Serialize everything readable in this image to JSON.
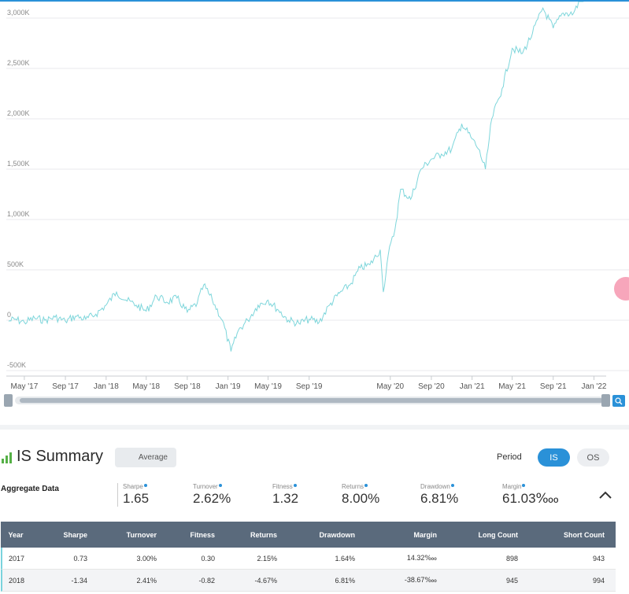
{
  "chart_data": {
    "type": "line",
    "series": [
      {
        "color": "#7ed6db",
        "points": [
          [
            "2017-03-15",
            -10000
          ],
          [
            "2017-04-01",
            10000
          ],
          [
            "2017-05-01",
            -20000
          ],
          [
            "2017-06-01",
            20000
          ],
          [
            "2017-07-01",
            0
          ],
          [
            "2017-08-01",
            30000
          ],
          [
            "2017-09-01",
            -10000
          ],
          [
            "2017-10-01",
            40000
          ],
          [
            "2017-11-01",
            10000
          ],
          [
            "2017-12-01",
            60000
          ],
          [
            "2018-01-01",
            150000
          ],
          [
            "2018-02-01",
            280000
          ],
          [
            "2018-03-01",
            200000
          ],
          [
            "2018-04-01",
            150000
          ],
          [
            "2018-05-01",
            90000
          ],
          [
            "2018-06-01",
            240000
          ],
          [
            "2018-07-01",
            180000
          ],
          [
            "2018-08-01",
            220000
          ],
          [
            "2018-09-01",
            80000
          ],
          [
            "2018-10-01",
            170000
          ],
          [
            "2018-10-20",
            350000
          ],
          [
            "2018-11-15",
            200000
          ],
          [
            "2018-12-15",
            0
          ],
          [
            "2019-01-10",
            -310000
          ],
          [
            "2019-02-01",
            -100000
          ],
          [
            "2019-03-01",
            0
          ],
          [
            "2019-04-01",
            150000
          ],
          [
            "2019-05-01",
            200000
          ],
          [
            "2019-06-01",
            100000
          ],
          [
            "2019-07-01",
            0
          ],
          [
            "2019-08-01",
            -30000
          ],
          [
            "2019-09-01",
            10000
          ],
          [
            "2019-10-01",
            -20000
          ],
          [
            "2019-11-01",
            150000
          ],
          [
            "2019-12-01",
            270000
          ],
          [
            "2020-01-01",
            350000
          ],
          [
            "2020-02-01",
            520000
          ],
          [
            "2020-03-01",
            550000
          ],
          [
            "2020-04-01",
            700000
          ],
          [
            "2020-04-10",
            280000
          ],
          [
            "2020-04-25",
            650000
          ],
          [
            "2020-05-15",
            900000
          ],
          [
            "2020-06-01",
            1300000
          ],
          [
            "2020-07-01",
            1200000
          ],
          [
            "2020-08-01",
            1500000
          ],
          [
            "2020-09-01",
            1600000
          ],
          [
            "2020-10-01",
            1650000
          ],
          [
            "2020-11-01",
            1700000
          ],
          [
            "2020-12-01",
            1950000
          ],
          [
            "2021-01-01",
            1800000
          ],
          [
            "2021-01-20",
            1700000
          ],
          [
            "2021-02-10",
            1500000
          ],
          [
            "2021-03-01",
            2000000
          ],
          [
            "2021-04-01",
            2300000
          ],
          [
            "2021-05-01",
            2700000
          ],
          [
            "2021-06-01",
            2650000
          ],
          [
            "2021-07-01",
            2850000
          ],
          [
            "2021-08-01",
            3100000
          ],
          [
            "2021-09-01",
            2900000
          ],
          [
            "2021-10-01",
            3050000
          ],
          [
            "2021-11-01",
            3050000
          ],
          [
            "2021-12-01",
            3250000
          ]
        ]
      }
    ],
    "x_type": "date",
    "y_ticks": [
      "3,000K",
      "2,500K",
      "2,000K",
      "1,500K",
      "1,000K",
      "500K",
      "0",
      "-500K"
    ],
    "x_ticks": [
      "May '17",
      "Sep '17",
      "Jan '18",
      "May '18",
      "Sep '18",
      "Jan '19",
      "May '19",
      "Sep '19",
      "May '20",
      "Sep '20",
      "Jan '21",
      "May '21",
      "Sep '21",
      "Jan '22"
    ],
    "ylim": [
      -500000,
      3250000
    ],
    "grid": true
  },
  "summary": {
    "title": "IS Summary",
    "average_label": "Average",
    "period_label": "Period",
    "period_options": [
      "IS",
      "OS"
    ],
    "aggregate_label": "Aggregate Data",
    "metrics": [
      {
        "label": "Sharpe",
        "value": "1.65"
      },
      {
        "label": "Turnover",
        "value": "2.62%"
      },
      {
        "label": "Fitness",
        "value": "1.32"
      },
      {
        "label": "Returns",
        "value": "8.00%"
      },
      {
        "label": "Drawdown",
        "value": "6.81%"
      },
      {
        "label": "Margin",
        "value": "61.03‱"
      }
    ]
  },
  "table": {
    "columns": [
      "Year",
      "Sharpe",
      "Turnover",
      "Fitness",
      "Returns",
      "Drawdown",
      "Margin",
      "Long Count",
      "Short Count"
    ],
    "rows": [
      [
        "2017",
        "0.73",
        "3.00%",
        "0.30",
        "2.15%",
        "1.64%",
        "14.32‱",
        "898",
        "943"
      ],
      [
        "2018",
        "-1.34",
        "2.41%",
        "-0.82",
        "-4.67%",
        "6.81%",
        "-38.67‱",
        "945",
        "994"
      ]
    ]
  },
  "colors": {
    "accent": "#2a91d8",
    "line": "#7ed6db",
    "header_bg": "#5a6a7c"
  }
}
